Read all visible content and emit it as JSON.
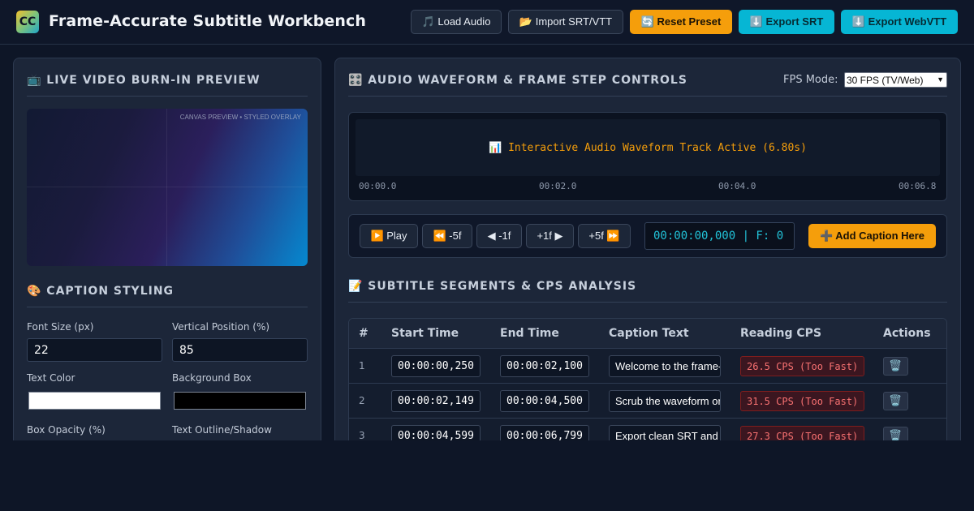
{
  "app": {
    "logo": "CC",
    "title": "Frame-Accurate Subtitle Workbench"
  },
  "header_buttons": {
    "load_audio": "🎵 Load Audio",
    "import": "📂 Import SRT/VTT",
    "reset": "🔄 Reset Preset",
    "export_srt": "⬇️ Export SRT",
    "export_vtt": "⬇️ Export WebVTT"
  },
  "preview": {
    "title": "📺 LIVE VIDEO BURN-IN PREVIEW",
    "overlay_label": "CANVAS PREVIEW • STYLED OVERLAY"
  },
  "styling": {
    "title": "🎨 CAPTION STYLING",
    "font_size_label": "Font Size (px)",
    "font_size_value": "22",
    "vertical_position_label": "Vertical Position (%)",
    "vertical_position_value": "85",
    "text_color_label": "Text Color",
    "text_color_value": "#ffffff",
    "background_box_label": "Background Box",
    "background_box_value": "#000000",
    "box_opacity_label": "Box Opacity (%)",
    "outline_label": "Text Outline/Shadow"
  },
  "waveform": {
    "title": "🎛️ AUDIO WAVEFORM & FRAME STEP CONTROLS",
    "fps_label": "FPS Mode:",
    "fps_value": "30 FPS (TV/Web)",
    "track_text": "📊 Interactive Audio Waveform Track Active (6.80s)",
    "ticks": [
      "00:00.0",
      "00:02.0",
      "00:04.0",
      "00:06.8"
    ]
  },
  "controls": {
    "play": "▶️ Play",
    "back5": "⏪ -5f",
    "back1": "◀ -1f",
    "fwd1": "+1f ▶",
    "fwd5": "+5f ⏩",
    "timecode": "00:00:00,000 | F: 0",
    "add_caption": "➕ Add Caption Here"
  },
  "segments": {
    "title": "📝 SUBTITLE SEGMENTS & CPS ANALYSIS",
    "columns": [
      "#",
      "Start Time",
      "End Time",
      "Caption Text",
      "Reading CPS",
      "Actions"
    ],
    "rows": [
      {
        "num": "1",
        "start": "00:00:00,250",
        "end": "00:00:02,100",
        "text": "Welcome to the frame-accurate subtitle workbench.",
        "cps": "26.5 CPS (Too Fast)",
        "delete": "🗑️"
      },
      {
        "num": "2",
        "start": "00:00:02,149",
        "end": "00:00:04,500",
        "text": "Scrub the waveform or step frame by frame to sync.",
        "cps": "31.5 CPS (Too Fast)",
        "delete": "🗑️"
      },
      {
        "num": "3",
        "start": "00:00:04,599",
        "end": "00:00:06,799",
        "text": "Export clean SRT and WebVTT files.",
        "cps": "27.3 CPS (Too Fast)",
        "delete": "🗑️"
      }
    ]
  }
}
